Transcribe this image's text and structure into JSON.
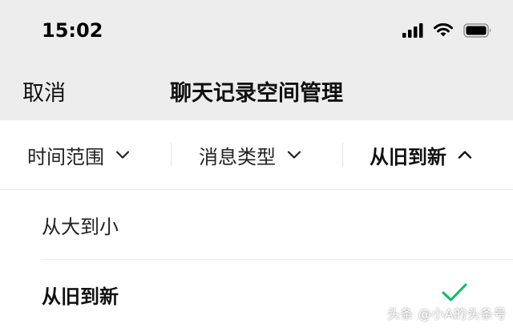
{
  "status_bar": {
    "time": "15:02"
  },
  "nav": {
    "cancel_label": "取消",
    "title": "聊天记录空间管理"
  },
  "filters": [
    {
      "label": "时间范围",
      "icon": "chevron-down-icon",
      "active": false
    },
    {
      "label": "消息类型",
      "icon": "chevron-down-icon",
      "active": false
    },
    {
      "label": "从旧到新",
      "icon": "chevron-up-icon",
      "active": true
    }
  ],
  "sort_options": [
    {
      "label": "从大到小",
      "selected": false
    },
    {
      "label": "从旧到新",
      "selected": true
    }
  ],
  "watermark": "头条 @小A的头条号",
  "colors": {
    "header_bg": "#ededed",
    "check": "#07c160"
  }
}
